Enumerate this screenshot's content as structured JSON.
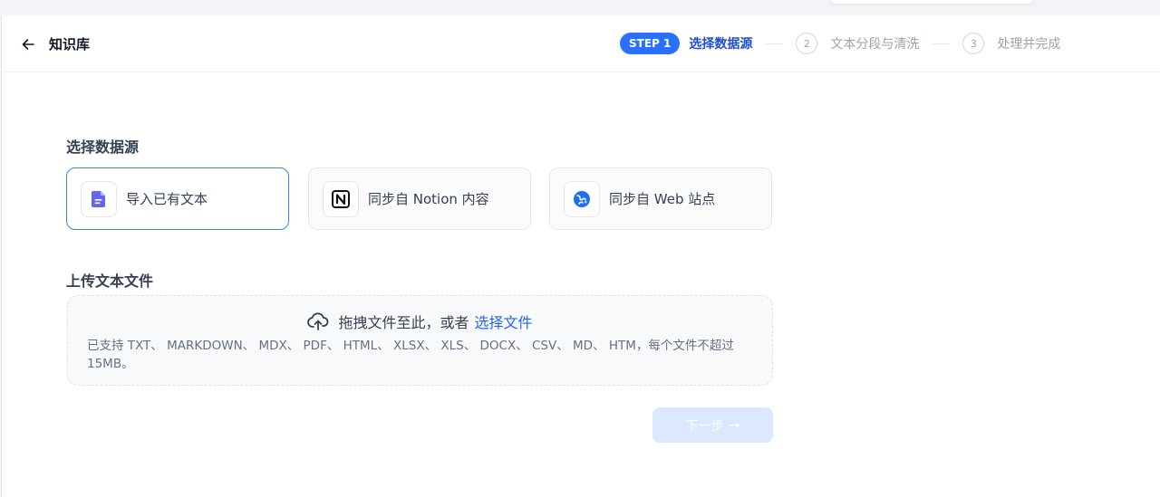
{
  "header": {
    "back_icon": "arrow-left-icon",
    "title": "知识库"
  },
  "stepper": {
    "steps": [
      {
        "badge": "STEP 1",
        "label": "选择数据源",
        "state": "active"
      },
      {
        "badge": "2",
        "label": "文本分段与清洗",
        "state": "pending"
      },
      {
        "badge": "3",
        "label": "处理并完成",
        "state": "pending"
      }
    ]
  },
  "source_section": {
    "title": "选择数据源",
    "options": [
      {
        "label": "导入已有文本",
        "icon": "document-icon",
        "selected": true
      },
      {
        "label": "同步自 Notion 内容",
        "icon": "notion-icon",
        "selected": false
      },
      {
        "label": "同步自 Web 站点",
        "icon": "web-icon",
        "selected": false
      }
    ]
  },
  "upload_section": {
    "title": "上传文本文件",
    "drop_text": "拖拽文件至此，或者",
    "select_link": "选择文件",
    "hint": "已支持 TXT、 MARKDOWN、 MDX、 PDF、 HTML、 XLSX、 XLS、 DOCX、 CSV、 MD、 HTM，每个文件不超过 15MB。",
    "cloud_icon": "cloud-upload-icon"
  },
  "actions": {
    "next_label": "下一步",
    "next_arrow": "→",
    "next_enabled": false
  },
  "colors": {
    "accent": "#2970ff",
    "link": "#2563eb",
    "selected_border": "#3b82f6",
    "disabled_button": "#dbe8ff"
  }
}
